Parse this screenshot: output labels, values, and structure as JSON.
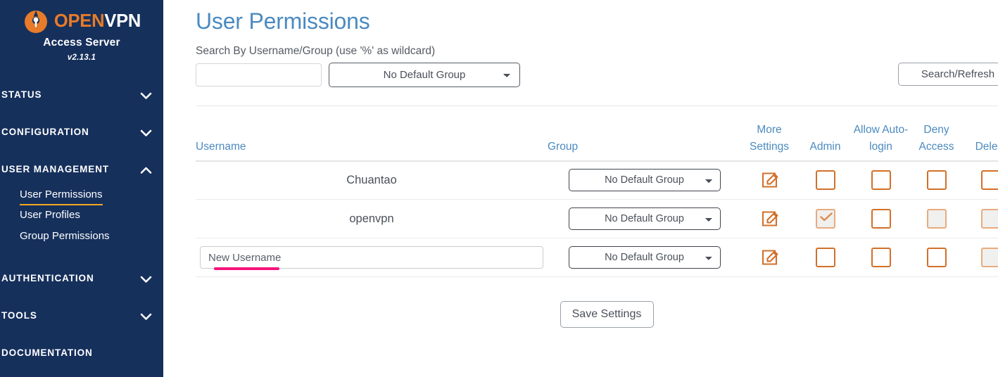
{
  "sidebar": {
    "logo": {
      "icon": "openvpn-shield-icon",
      "word_primary": "OPEN",
      "word_secondary": "VPN",
      "subtitle": "Access Server",
      "version": "v2.13.1",
      "brand_orange": "#e77b29",
      "background": "#16305c"
    },
    "sections": [
      {
        "label": "STATUS",
        "icon": "chevron-down-icon",
        "expanded": false,
        "items": []
      },
      {
        "label": "CONFIGURATION",
        "icon": "chevron-down-icon",
        "expanded": false,
        "items": []
      },
      {
        "label": "USER  MANAGEMENT",
        "icon": "chevron-up-icon",
        "expanded": true,
        "items": [
          {
            "label": "User Permissions",
            "active": true
          },
          {
            "label": "User Profiles",
            "active": false
          },
          {
            "label": "Group Permissions",
            "active": false
          }
        ]
      },
      {
        "label": "AUTHENTICATION",
        "icon": "chevron-down-icon",
        "expanded": false,
        "items": []
      },
      {
        "label": "TOOLS",
        "icon": "chevron-down-icon",
        "expanded": false,
        "items": []
      },
      {
        "label": "DOCUMENTATION",
        "icon": "",
        "expanded": false,
        "items": []
      }
    ],
    "active_underline_color": "#f5a623"
  },
  "main": {
    "title": "User Permissions",
    "title_color": "#4b8ac0",
    "search": {
      "label": "Search By Username/Group (use '%' as wildcard)",
      "input_value": "",
      "input_placeholder": "",
      "group_selected": "No Default Group",
      "group_options": [
        "No Default Group"
      ],
      "button_label": "Search/Refresh"
    },
    "table": {
      "headers": {
        "username": "Username",
        "group": "Group",
        "more_settings": "More Settings",
        "admin": "Admin",
        "allow_autologin": "Allow Auto-login",
        "deny_access": "Deny Access",
        "delete": "Delete"
      },
      "rows": [
        {
          "username": "Chuantao",
          "is_new_row": false,
          "group_selected": "No Default Group",
          "more_settings_icon": "edit-pencil-icon",
          "admin": {
            "checked": false,
            "disabled": false
          },
          "allow_autologin": {
            "checked": false,
            "disabled": false
          },
          "deny_access": {
            "checked": false,
            "disabled": false
          },
          "delete": {
            "checked": false,
            "disabled": false
          }
        },
        {
          "username": "openvpn",
          "is_new_row": false,
          "group_selected": "No Default Group",
          "more_settings_icon": "edit-pencil-icon",
          "admin": {
            "checked": true,
            "disabled": true
          },
          "allow_autologin": {
            "checked": false,
            "disabled": false
          },
          "deny_access": {
            "checked": false,
            "disabled": true
          },
          "delete": {
            "checked": false,
            "disabled": true
          }
        },
        {
          "username": "",
          "is_new_row": true,
          "new_username_placeholder": "New Username",
          "group_selected": "No Default Group",
          "more_settings_icon": "edit-pencil-icon",
          "admin": {
            "checked": false,
            "disabled": false
          },
          "allow_autologin": {
            "checked": false,
            "disabled": false
          },
          "deny_access": {
            "checked": false,
            "disabled": false
          },
          "delete": {
            "checked": false,
            "disabled": true
          }
        }
      ],
      "annotation_underline_color": "#f4147c"
    },
    "save_button_label": "Save Settings",
    "checkbox_border_color": "#d2702a",
    "checkbox_disabled_border_color": "#e8ab7e"
  }
}
